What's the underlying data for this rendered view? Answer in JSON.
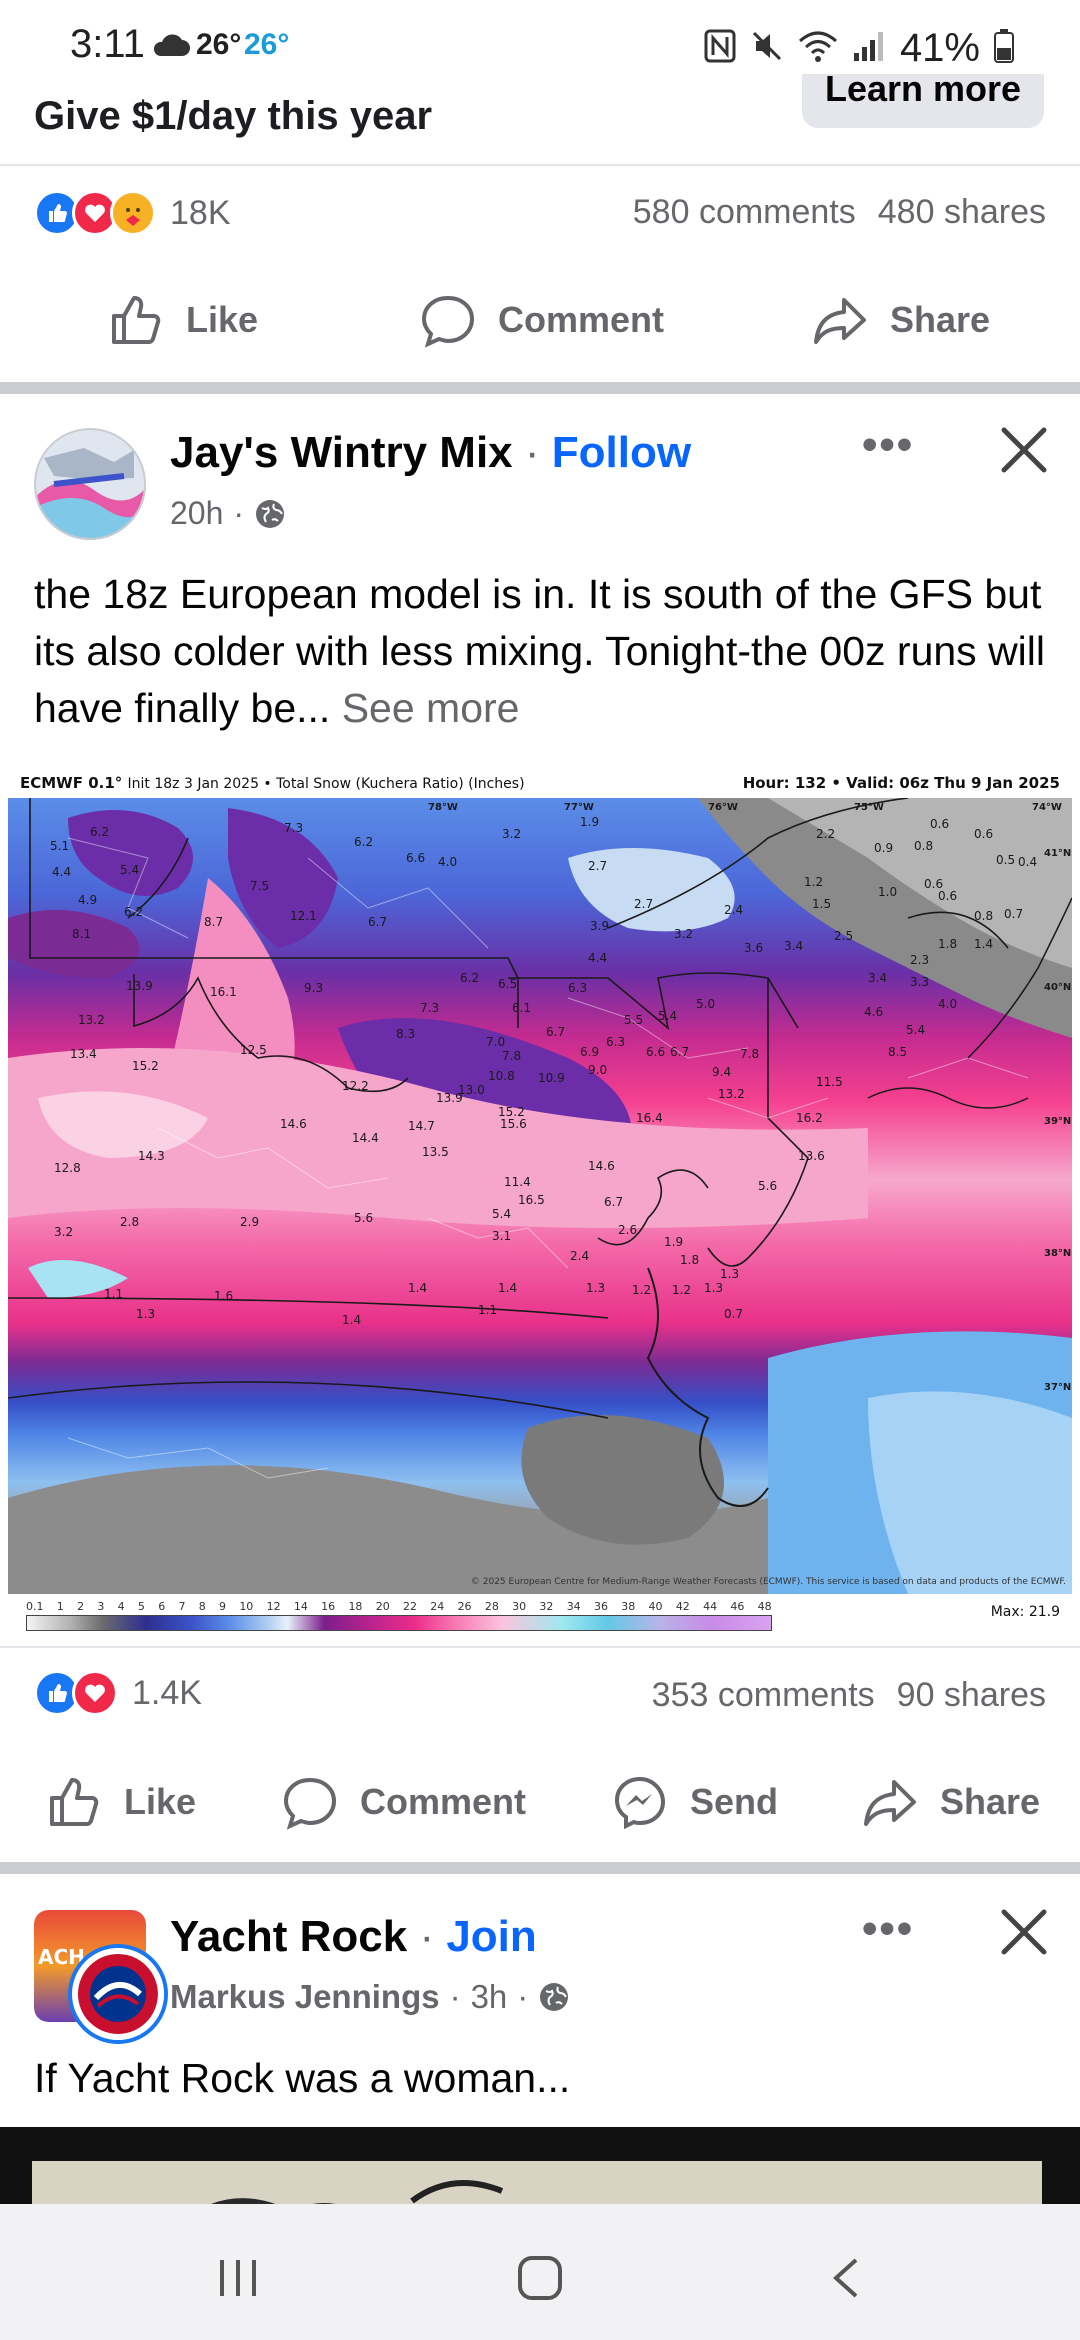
{
  "status_bar": {
    "time": "3:11",
    "temp1": "26°",
    "temp2": "26°",
    "battery": "41%"
  },
  "ad": {
    "title": "Give $1/day this year",
    "learn_more": "Learn more",
    "reaction_count": "18K",
    "comments": "580 comments",
    "shares": "480 shares",
    "actions": {
      "like": "Like",
      "comment": "Comment",
      "share": "Share"
    }
  },
  "post1": {
    "author": "Jay's Wintry Mix",
    "follow": "Follow",
    "time": "20h",
    "text": "the 18z European model is in. It is south of the GFS but its also colder with less mixing. Tonight-the 00z runs will have finally be...",
    "see_more": "See more",
    "reaction_count": "1.4K",
    "comments": "353 comments",
    "shares": "90 shares",
    "actions": {
      "like": "Like",
      "comment": "Comment",
      "send": "Send",
      "share": "Share"
    },
    "image": {
      "header_left": "ECMWF 0.1°",
      "header_left_sub": "Init 18z 3 Jan 2025 • Total Snow (Kuchera Ratio) (Inches)",
      "header_right": "Hour: 132 • Valid: 06z Thu 9 Jan 2025",
      "max": "Max: 21.9",
      "copyright": "© 2025 European Centre for Medium-Range Weather Forecasts (ECMWF). This service is based on data and products of the ECMWF.",
      "legend_ticks": [
        "0.1",
        "1",
        "2",
        "3",
        "4",
        "5",
        "6",
        "7",
        "8",
        "9",
        "10",
        "12",
        "14",
        "16",
        "18",
        "20",
        "22",
        "24",
        "26",
        "28",
        "30",
        "32",
        "34",
        "36",
        "38",
        "40",
        "42",
        "44",
        "46",
        "48"
      ],
      "map_values": [
        "7.3",
        "6.2",
        "3.2",
        "1.9",
        "2.2",
        "0.6",
        "0.6",
        "5.1",
        "6.2",
        "6.6",
        "4.0",
        "2.7",
        "0.9",
        "0.8",
        "0.5",
        "0.4",
        "4.4",
        "5.4",
        "7.5",
        "1.2",
        "1.0",
        "0.6",
        "0.6",
        "4.9",
        "6.2",
        "12.1",
        "6.7",
        "2.7",
        "2.4",
        "1.5",
        "0.8",
        "0.7",
        "8.1",
        "8.7",
        "3.9",
        "3.2",
        "3.6",
        "3.4",
        "2.5",
        "1.8",
        "1.4",
        "4.4",
        "2.3",
        "13.9",
        "16.1",
        "9.3",
        "6.2",
        "6.5",
        "6.3",
        "3.4",
        "3.3",
        "13.2",
        "7.3",
        "6.1",
        "5.5",
        "5.4",
        "5.0",
        "4.6",
        "4.0",
        "13.4",
        "12.5",
        "8.3",
        "6.7",
        "6.3",
        "6.6",
        "6.7",
        "7.8",
        "5.4",
        "15.2",
        "7.0",
        "7.8",
        "6.9",
        "9.0",
        "9.4",
        "8.5",
        "12.2",
        "10.8",
        "10.9",
        "11.5",
        "13.9",
        "13.0",
        "15.2",
        "13.2",
        "16.2",
        "14.6",
        "14.7",
        "15.6",
        "14.4",
        "13.5",
        "14.3",
        "14.6",
        "12.8",
        "11.4",
        "5.6",
        "16.5",
        "6.7",
        "3.2",
        "2.8",
        "2.9",
        "5.6",
        "5.4",
        "3.1",
        "2.6",
        "1.9",
        "2.4",
        "1.8",
        "1.3",
        "1.1",
        "1.6",
        "1.4",
        "1.4",
        "1.3",
        "1.2",
        "1.2",
        "1.3",
        "1.3",
        "1.4",
        "1.1",
        "0.7"
      ]
    }
  },
  "post2": {
    "group": "Yacht Rock",
    "join": "Join",
    "author": "Markus Jennings",
    "time": "3h",
    "text": "If Yacht Rock was a woman..."
  }
}
